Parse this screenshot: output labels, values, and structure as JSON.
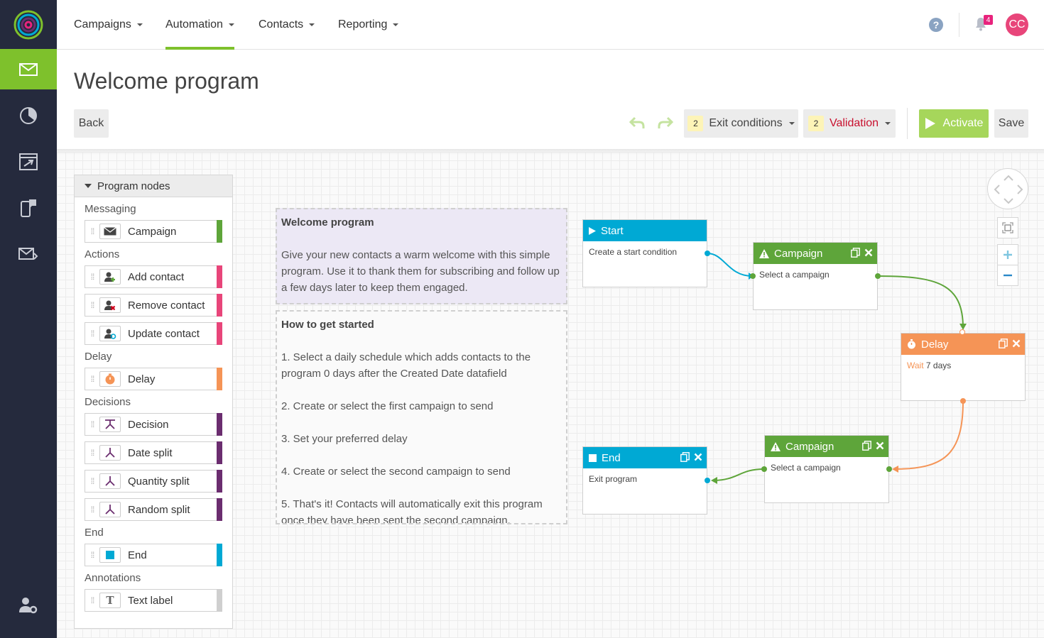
{
  "app": {
    "nav": [
      {
        "label": "Campaigns"
      },
      {
        "label": "Automation"
      },
      {
        "label": "Contacts"
      },
      {
        "label": "Reporting"
      }
    ],
    "notifications_count": "4",
    "user_initials": "CC"
  },
  "page": {
    "title": "Welcome program",
    "back_label": "Back",
    "exit_conditions": {
      "count": "2",
      "label": "Exit conditions"
    },
    "validation": {
      "count": "2",
      "label": "Validation"
    },
    "activate_label": "Activate",
    "save_label": "Save"
  },
  "panel": {
    "title": "Program nodes",
    "sections": {
      "messaging": "Messaging",
      "actions": "Actions",
      "delay": "Delay",
      "decisions": "Decisions",
      "end": "End",
      "annotations": "Annotations"
    },
    "items": {
      "campaign": "Campaign",
      "add_contact": "Add contact",
      "remove_contact": "Remove contact",
      "update_contact": "Update contact",
      "delay": "Delay",
      "decision": "Decision",
      "date_split": "Date split",
      "quantity_split": "Quantity split",
      "random_split": "Random split",
      "end": "End",
      "text_label": "Text label"
    }
  },
  "notes": {
    "welcome": {
      "title": "Welcome program",
      "body": "Give your new contacts a warm welcome with this simple program.  Use it to thank them for subscribing and follow up a few days later to keep them engaged."
    },
    "howto": {
      "title": "How to get started",
      "steps": [
        "1. Select a daily schedule which adds contacts to the program 0 days after the Created Date datafield",
        "2. Create or select the first campaign to send",
        "3. Set your preferred delay",
        "4. Create or select the second campaign to send",
        "5. That's it! Contacts will automatically exit this program once they have been sent the second campaign."
      ]
    }
  },
  "flow": {
    "start": {
      "title": "Start",
      "body": "Create a start condition"
    },
    "campaign1": {
      "title": "Campaign",
      "body": "Select a campaign"
    },
    "delay": {
      "title": "Delay",
      "body_prefix": "Wait",
      "body_value": "7 days"
    },
    "campaign2": {
      "title": "Campaign",
      "body": "Select a campaign"
    },
    "end": {
      "title": "End",
      "body": "Exit program"
    }
  },
  "colors": {
    "brand_green": "#7ec12c",
    "start_blue": "#00a9d4",
    "campaign_green": "#5ea53a",
    "delay_orange": "#f59456",
    "decision_purple": "#6b2d6f",
    "action_pink": "#e8457a",
    "rail_dark": "#252a3d"
  }
}
